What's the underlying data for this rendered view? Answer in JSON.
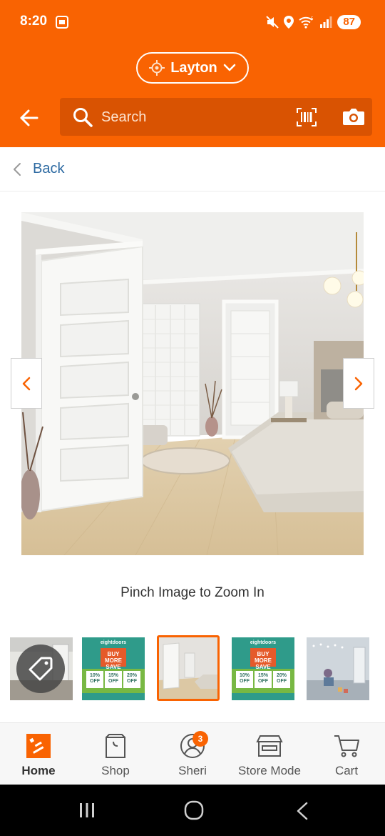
{
  "status_bar": {
    "time": "8:20",
    "battery": "87",
    "wifi_label": "5"
  },
  "header": {
    "store": "Layton",
    "search_placeholder": "Search"
  },
  "back_row": {
    "label": "Back"
  },
  "product_image": {
    "zoom_hint": "Pinch Image to Zoom In"
  },
  "thumbnails": {
    "promo_brand": "eightdoors",
    "promo_save": "BUY MORE SAVE MORE",
    "promo_off": [
      "10% OFF",
      "15% OFF",
      "20% OFF"
    ],
    "selected_index": 2
  },
  "bottom_nav": {
    "items": [
      {
        "label": "Home",
        "icon": "home-depot-logo-icon"
      },
      {
        "label": "Shop",
        "icon": "shop-bag-icon"
      },
      {
        "label": "Sheri",
        "icon": "user-icon",
        "badge": "3"
      },
      {
        "label": "Store Mode",
        "icon": "store-icon"
      },
      {
        "label": "Cart",
        "icon": "cart-icon"
      }
    ]
  },
  "colors": {
    "brand": "#f96302",
    "link": "#2d6aa2"
  }
}
